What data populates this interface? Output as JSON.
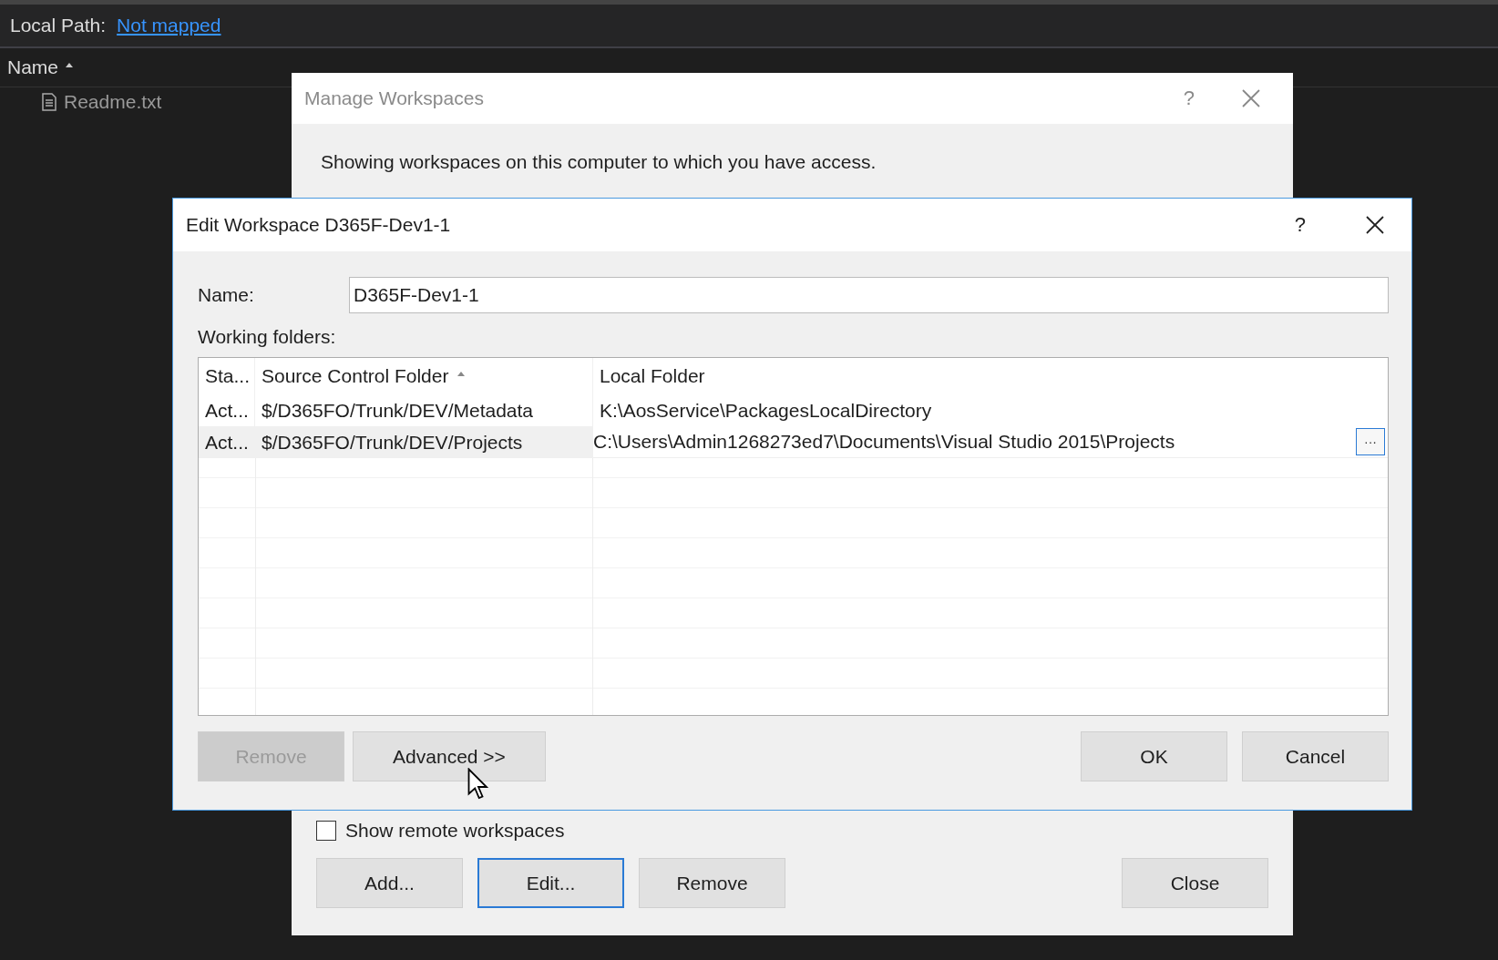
{
  "explorer": {
    "local_path_label": "Local Path:",
    "local_path_link": "Not mapped",
    "columns": [
      {
        "label": "Name",
        "sorted": true
      }
    ],
    "files": [
      {
        "name": "Readme.txt"
      }
    ]
  },
  "manage_dialog": {
    "title": "Manage Workspaces",
    "help": "?",
    "description": "Showing workspaces on this computer to which you have access.",
    "show_remote": {
      "label": "Show remote workspaces",
      "checked": false
    },
    "buttons": [
      {
        "label": "Add...",
        "focused": false,
        "disabled": false
      },
      {
        "label": "Edit...",
        "focused": true,
        "disabled": false
      },
      {
        "label": "Remove",
        "focused": false,
        "disabled": false
      }
    ],
    "close_button": {
      "label": "Close",
      "focused": false,
      "disabled": false
    }
  },
  "edit_dialog": {
    "title": "Edit Workspace D365F-Dev1-1",
    "help": "?",
    "name_label": "Name:",
    "name_value": "D365F-Dev1-1",
    "folders_label": "Working folders:",
    "columns": [
      {
        "label": "Sta..."
      },
      {
        "label": "Source Control Folder",
        "sorted": true
      },
      {
        "label": "Local Folder"
      }
    ],
    "rows": [
      {
        "status": "Act...",
        "source": "$/D365FO/Trunk/DEV/Metadata",
        "local": "K:\\AosService\\PackagesLocalDirectory",
        "selected": false,
        "editing": false
      },
      {
        "status": "Act...",
        "source": "$/D365FO/Trunk/DEV/Projects",
        "local": "C:\\Users\\Admin1268273ed7\\Documents\\Visual Studio 2015\\Projects",
        "selected": true,
        "editing": true
      }
    ],
    "browse_label": "···",
    "left_buttons": [
      {
        "label": "Remove",
        "focused": false,
        "disabled": true
      },
      {
        "label": "Advanced >>",
        "focused": false,
        "disabled": false
      }
    ],
    "right_buttons": [
      {
        "label": "OK",
        "focused": false,
        "disabled": false
      },
      {
        "label": "Cancel",
        "focused": false,
        "disabled": false
      }
    ]
  }
}
